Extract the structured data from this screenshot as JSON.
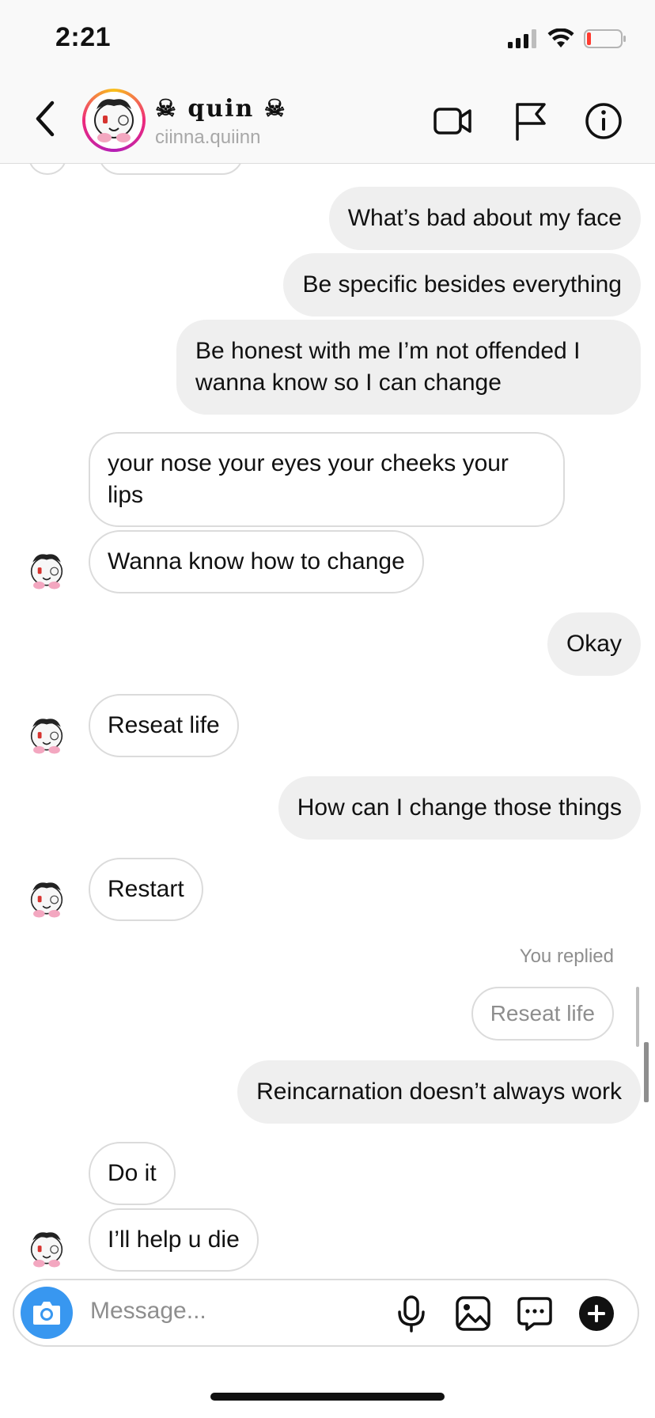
{
  "status": {
    "time": "2:21"
  },
  "header": {
    "name": "☠ quin ☠",
    "username": "ciinna.quiinn",
    "icons": [
      "back-chevron-icon",
      "video-camera-icon",
      "flag-icon",
      "info-icon"
    ]
  },
  "messages": [
    {
      "direction": "outgoing",
      "text": "What’s bad about my face"
    },
    {
      "direction": "outgoing",
      "text": "Be specific besides everything"
    },
    {
      "direction": "outgoing",
      "text": "Be honest with me I’m not offended I wanna know so I can change"
    },
    {
      "direction": "incoming",
      "text": "your nose your eyes your cheeks your lips"
    },
    {
      "direction": "incoming",
      "text": "Wanna know how to change"
    },
    {
      "direction": "outgoing",
      "text": "Okay"
    },
    {
      "direction": "incoming",
      "text": "Reseat life"
    },
    {
      "direction": "outgoing",
      "text": "How can I change those things"
    },
    {
      "direction": "incoming",
      "text": "Restart"
    },
    {
      "direction": "outgoing",
      "reply_label": "You replied",
      "quoted_text": "Reseat life",
      "text": "Reincarnation doesn’t always work"
    },
    {
      "direction": "incoming",
      "text": "Do it"
    },
    {
      "direction": "incoming",
      "text": "I’ll help u die"
    }
  ],
  "composer": {
    "placeholder": "Message...",
    "icons": [
      "camera-icon",
      "microphone-icon",
      "gallery-icon",
      "sticker-chat-icon",
      "add-icon"
    ]
  },
  "colors": {
    "accent": "#3897f0",
    "outgoing_bubble": "#efefef",
    "incoming_border": "#dbdbdb",
    "battery_low": "#ff3b30"
  }
}
